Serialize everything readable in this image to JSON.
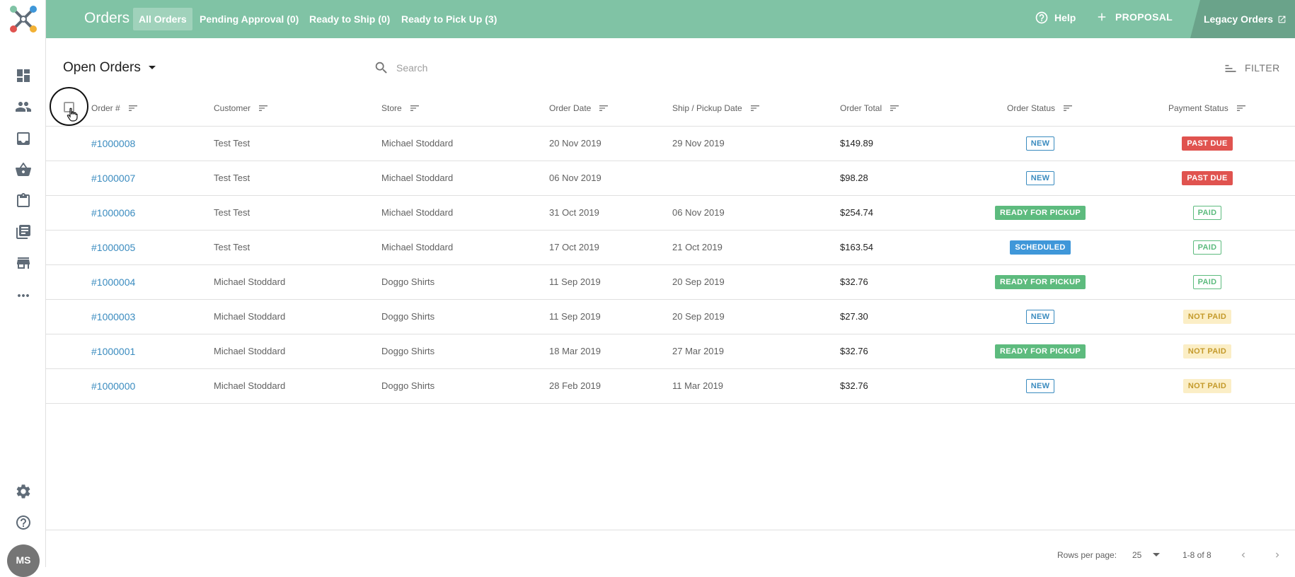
{
  "app": {
    "title": "Orders"
  },
  "tabs": [
    {
      "label": "All Orders",
      "active": true
    },
    {
      "label": "Pending Approval (0)",
      "active": false
    },
    {
      "label": "Ready to Ship (0)",
      "active": false
    },
    {
      "label": "Ready to Pick Up (3)",
      "active": false
    }
  ],
  "header": {
    "help_label": "Help",
    "proposal_label": "PROPOSAL",
    "legacy_label": "Legacy Orders"
  },
  "sidebar": {
    "icons": [
      "dashboard-icon",
      "people-icon",
      "inbox-icon",
      "basket-icon",
      "clipboard-icon",
      "library-icon",
      "store-icon",
      "more-icon",
      "settings-icon",
      "help-icon"
    ],
    "avatar_initials": "MS"
  },
  "toolbar": {
    "view_label": "Open Orders",
    "search_placeholder": "Search",
    "filter_label": "FILTER"
  },
  "table": {
    "columns": [
      "Order #",
      "Customer",
      "Store",
      "Order Date",
      "Ship / Pickup Date",
      "Order Total",
      "Order Status",
      "Payment Status"
    ],
    "rows": [
      {
        "order": "#1000008",
        "customer": "Test Test",
        "store": "Michael Stoddard",
        "order_date": "20 Nov 2019",
        "ship_date": "29 Nov 2019",
        "total": "$149.89",
        "status": "NEW",
        "payment": "PAST DUE"
      },
      {
        "order": "#1000007",
        "customer": "Test Test",
        "store": "Michael Stoddard",
        "order_date": "06 Nov 2019",
        "ship_date": "",
        "total": "$98.28",
        "status": "NEW",
        "payment": "PAST DUE"
      },
      {
        "order": "#1000006",
        "customer": "Test Test",
        "store": "Michael Stoddard",
        "order_date": "31 Oct 2019",
        "ship_date": "06 Nov 2019",
        "total": "$254.74",
        "status": "READY FOR PICKUP",
        "payment": "PAID"
      },
      {
        "order": "#1000005",
        "customer": "Test Test",
        "store": "Michael Stoddard",
        "order_date": "17 Oct 2019",
        "ship_date": "21 Oct 2019",
        "total": "$163.54",
        "status": "SCHEDULED",
        "payment": "PAID"
      },
      {
        "order": "#1000004",
        "customer": "Michael Stoddard",
        "store": "Doggo Shirts",
        "order_date": "11 Sep 2019",
        "ship_date": "20 Sep 2019",
        "total": "$32.76",
        "status": "READY FOR PICKUP",
        "payment": "PAID"
      },
      {
        "order": "#1000003",
        "customer": "Michael Stoddard",
        "store": "Doggo Shirts",
        "order_date": "11 Sep 2019",
        "ship_date": "20 Sep 2019",
        "total": "$27.30",
        "status": "NEW",
        "payment": "NOT PAID"
      },
      {
        "order": "#1000001",
        "customer": "Michael Stoddard",
        "store": "Doggo Shirts",
        "order_date": "18 Mar 2019",
        "ship_date": "27 Mar 2019",
        "total": "$32.76",
        "status": "READY FOR PICKUP",
        "payment": "NOT PAID"
      },
      {
        "order": "#1000000",
        "customer": "Michael Stoddard",
        "store": "Doggo Shirts",
        "order_date": "28 Feb 2019",
        "ship_date": "11 Mar 2019",
        "total": "$32.76",
        "status": "NEW",
        "payment": "NOT PAID"
      }
    ]
  },
  "footer": {
    "rows_per_page_label": "Rows per page:",
    "rows_per_page_value": "25",
    "range": "1-8 of 8"
  },
  "colors": {
    "header_bg": "#80c3a5",
    "link": "#3a8bbf",
    "ready": "#5dbb7e",
    "scheduled": "#3f97d9",
    "past_due": "#e0534f",
    "not_paid_bg": "#fbeec6"
  }
}
